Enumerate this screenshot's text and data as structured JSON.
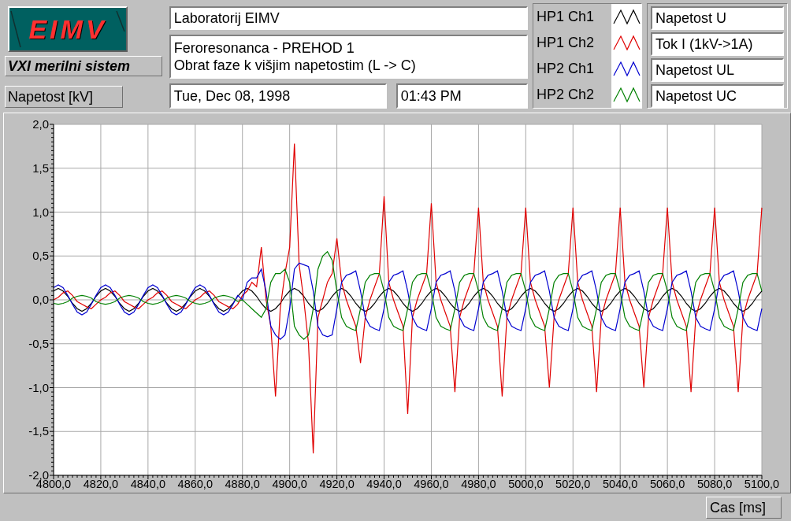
{
  "logo": {
    "text": "EIMV"
  },
  "system_label": "VXI merilni sistem",
  "y_axis_label": "Napetost [kV]",
  "header": {
    "lab": "Laboratorij EIMV",
    "description": [
      "Feroresonanca - PREHOD 1",
      "Obrat faze k višjim napetostim (L -> C)"
    ],
    "date": "Tue, Dec 08, 1998",
    "time": "01:43 PM"
  },
  "signals": [
    "Napetost U",
    "Tok I (1kV->1A)",
    "Napetost UL",
    "Napetost UC"
  ],
  "chart_data": {
    "type": "line",
    "grid": true,
    "xlim": [
      4800,
      5100
    ],
    "ylim": [
      -2,
      2
    ],
    "yticks": [
      {
        "value": 2,
        "label": "2,0"
      },
      {
        "value": 1.5,
        "label": "1,5"
      },
      {
        "value": 1,
        "label": "1,0"
      },
      {
        "value": 0.5,
        "label": "0,5"
      },
      {
        "value": 0,
        "label": "0,0"
      },
      {
        "value": -0.5,
        "label": "-0,5"
      },
      {
        "value": -1,
        "label": "-1,0"
      },
      {
        "value": -1.5,
        "label": "-1,5"
      },
      {
        "value": -2,
        "label": "-2,0"
      }
    ],
    "xticks": [
      {
        "value": 4800,
        "label": "4800,0"
      },
      {
        "value": 4820,
        "label": "4820,0"
      },
      {
        "value": 4840,
        "label": "4840,0"
      },
      {
        "value": 4860,
        "label": "4860,0"
      },
      {
        "value": 4880,
        "label": "4880,0"
      },
      {
        "value": 4900,
        "label": "4900,0"
      },
      {
        "value": 4920,
        "label": "4920,0"
      },
      {
        "value": 4940,
        "label": "4940,0"
      },
      {
        "value": 4960,
        "label": "4960,0"
      },
      {
        "value": 4980,
        "label": "4980,0"
      },
      {
        "value": 5000,
        "label": "5000,0"
      },
      {
        "value": 5020,
        "label": "5020,0"
      },
      {
        "value": 5040,
        "label": "5040,0"
      },
      {
        "value": 5060,
        "label": "5060,0"
      },
      {
        "value": 5080,
        "label": "5080,0"
      },
      {
        "value": 5100,
        "label": "5100,0"
      }
    ],
    "x": [
      4800,
      4802,
      4804,
      4806,
      4808,
      4810,
      4812,
      4814,
      4816,
      4818,
      4820,
      4822,
      4824,
      4826,
      4828,
      4830,
      4832,
      4834,
      4836,
      4838,
      4840,
      4842,
      4844,
      4846,
      4848,
      4850,
      4852,
      4854,
      4856,
      4858,
      4860,
      4862,
      4864,
      4866,
      4868,
      4870,
      4872,
      4874,
      4876,
      4878,
      4880,
      4882,
      4884,
      4886,
      4888,
      4890,
      4892,
      4894,
      4896,
      4898,
      4900,
      4902,
      4904,
      4906,
      4908,
      4910,
      4912,
      4914,
      4916,
      4918,
      4920,
      4922,
      4924,
      4926,
      4928,
      4930,
      4932,
      4934,
      4936,
      4938,
      4940,
      4942,
      4944,
      4946,
      4948,
      4950,
      4952,
      4954,
      4956,
      4958,
      4960,
      4962,
      4964,
      4966,
      4968,
      4970,
      4972,
      4974,
      4976,
      4978,
      4980,
      4982,
      4984,
      4986,
      4988,
      4990,
      4992,
      4994,
      4996,
      4998,
      5000,
      5002,
      5004,
      5006,
      5008,
      5010,
      5012,
      5014,
      5016,
      5018,
      5020,
      5022,
      5024,
      5026,
      5028,
      5030,
      5032,
      5034,
      5036,
      5038,
      5040,
      5042,
      5044,
      5046,
      5048,
      5050,
      5052,
      5054,
      5056,
      5058,
      5060,
      5062,
      5064,
      5066,
      5068,
      5070,
      5072,
      5074,
      5076,
      5078,
      5080,
      5082,
      5084,
      5086,
      5088,
      5090,
      5092,
      5094,
      5096,
      5098,
      5100
    ],
    "series": [
      {
        "name": "HP1 Ch1",
        "color": "#000000",
        "values": [
          0.1,
          0.13,
          0.1,
          0.04,
          -0.04,
          -0.1,
          -0.13,
          -0.1,
          -0.04,
          0.04,
          0.1,
          0.13,
          0.1,
          0.04,
          -0.04,
          -0.1,
          -0.13,
          -0.1,
          -0.04,
          0.04,
          0.1,
          0.13,
          0.1,
          0.04,
          -0.04,
          -0.1,
          -0.13,
          -0.1,
          -0.04,
          0.04,
          0.1,
          0.13,
          0.1,
          0.04,
          -0.04,
          -0.1,
          -0.13,
          -0.1,
          -0.04,
          0.04,
          0.1,
          0.13,
          0.1,
          0.04,
          -0.04,
          -0.1,
          -0.13,
          -0.1,
          -0.04,
          0.04,
          0.1,
          0.13,
          0.1,
          0.04,
          -0.04,
          -0.1,
          -0.13,
          -0.1,
          -0.04,
          0.04,
          0.1,
          0.13,
          0.1,
          0.04,
          -0.04,
          -0.1,
          -0.13,
          -0.1,
          -0.04,
          0.04,
          0.1,
          0.13,
          0.1,
          0.04,
          -0.04,
          -0.1,
          -0.13,
          -0.1,
          -0.04,
          0.04,
          0.1,
          0.13,
          0.1,
          0.04,
          -0.04,
          -0.1,
          -0.13,
          -0.1,
          -0.04,
          0.04,
          0.1,
          0.13,
          0.1,
          0.04,
          -0.04,
          -0.1,
          -0.13,
          -0.1,
          -0.04,
          0.04,
          0.1,
          0.13,
          0.1,
          0.04,
          -0.04,
          -0.1,
          -0.13,
          -0.1,
          -0.04,
          0.04,
          0.1,
          0.13,
          0.1,
          0.04,
          -0.04,
          -0.1,
          -0.13,
          -0.1,
          -0.04,
          0.04,
          0.1,
          0.13,
          0.1,
          0.04,
          -0.04,
          -0.1,
          -0.13,
          -0.1,
          -0.04,
          0.04,
          0.1,
          0.13,
          0.1,
          0.04,
          -0.04,
          -0.1,
          -0.13,
          -0.1,
          -0.04,
          0.04,
          0.1,
          0.13,
          0.1,
          0.04,
          -0.04,
          -0.1,
          -0.13,
          -0.1,
          -0.04,
          0.04,
          0.1
        ]
      },
      {
        "name": "HP1 Ch2",
        "color": "#e00000",
        "values": [
          0.0,
          0.03,
          0.08,
          0.1,
          0.05,
          -0.02,
          -0.05,
          -0.08,
          -0.1,
          -0.05,
          0.0,
          0.03,
          0.08,
          0.1,
          0.05,
          -0.02,
          -0.05,
          -0.08,
          -0.1,
          -0.05,
          0.0,
          0.03,
          0.08,
          0.1,
          0.05,
          -0.02,
          -0.05,
          -0.08,
          -0.1,
          -0.05,
          0.0,
          0.03,
          0.08,
          0.1,
          0.05,
          -0.02,
          -0.05,
          -0.08,
          -0.1,
          -0.05,
          0.05,
          0.1,
          0.2,
          0.15,
          0.6,
          0.0,
          -0.3,
          -1.1,
          -0.1,
          0.3,
          0.6,
          1.78,
          0.4,
          0.0,
          -0.5,
          -1.75,
          -0.2,
          0.0,
          0.2,
          0.3,
          0.7,
          0.2,
          0.0,
          -0.15,
          -0.3,
          -0.72,
          -0.2,
          0.0,
          0.15,
          0.3,
          1.18,
          0.2,
          0.0,
          -0.15,
          -0.3,
          -1.3,
          -0.2,
          0.0,
          0.15,
          0.3,
          1.1,
          0.2,
          0.0,
          -0.15,
          -0.3,
          -1.05,
          -0.2,
          0.0,
          0.15,
          0.3,
          1.05,
          0.2,
          0.0,
          -0.15,
          -0.3,
          -1.1,
          -0.2,
          0.0,
          0.15,
          0.3,
          1.05,
          0.2,
          0.0,
          -0.15,
          -0.3,
          -1.0,
          -0.2,
          0.0,
          0.15,
          0.3,
          1.05,
          0.2,
          0.0,
          -0.15,
          -0.3,
          -1.05,
          -0.2,
          0.0,
          0.15,
          0.3,
          1.05,
          0.2,
          0.0,
          -0.15,
          -0.3,
          -1.0,
          -0.2,
          0.0,
          0.15,
          0.3,
          1.05,
          0.2,
          0.0,
          -0.15,
          -0.3,
          -1.05,
          -0.2,
          0.0,
          0.15,
          0.3,
          1.05,
          0.2,
          0.0,
          -0.15,
          -0.3,
          -1.05,
          -0.2,
          0.0,
          0.15,
          0.3,
          1.05
        ]
      },
      {
        "name": "HP2 Ch1",
        "color": "#0000d0",
        "values": [
          0.14,
          0.17,
          0.14,
          0.05,
          -0.05,
          -0.14,
          -0.17,
          -0.14,
          -0.05,
          0.05,
          0.14,
          0.17,
          0.14,
          0.05,
          -0.05,
          -0.14,
          -0.17,
          -0.14,
          -0.05,
          0.05,
          0.14,
          0.17,
          0.14,
          0.05,
          -0.05,
          -0.14,
          -0.17,
          -0.14,
          -0.05,
          0.05,
          0.14,
          0.17,
          0.14,
          0.05,
          -0.05,
          -0.14,
          -0.17,
          -0.14,
          -0.05,
          0.05,
          0.0,
          0.2,
          0.25,
          0.25,
          0.35,
          0.1,
          -0.3,
          -0.4,
          -0.45,
          -0.4,
          -0.1,
          0.35,
          0.42,
          0.4,
          0.38,
          0.1,
          -0.3,
          -0.4,
          -0.42,
          -0.4,
          -0.1,
          0.2,
          0.28,
          0.3,
          0.33,
          0.1,
          -0.2,
          -0.3,
          -0.33,
          -0.35,
          -0.1,
          0.2,
          0.28,
          0.3,
          0.33,
          0.1,
          -0.2,
          -0.3,
          -0.33,
          -0.35,
          -0.1,
          0.2,
          0.28,
          0.3,
          0.33,
          0.1,
          -0.2,
          -0.3,
          -0.33,
          -0.35,
          -0.1,
          0.2,
          0.28,
          0.3,
          0.33,
          0.1,
          -0.2,
          -0.3,
          -0.33,
          -0.35,
          -0.1,
          0.2,
          0.28,
          0.3,
          0.33,
          0.1,
          -0.2,
          -0.3,
          -0.33,
          -0.35,
          -0.1,
          0.2,
          0.28,
          0.3,
          0.33,
          0.1,
          -0.2,
          -0.3,
          -0.33,
          -0.35,
          -0.1,
          0.2,
          0.28,
          0.3,
          0.33,
          0.1,
          -0.2,
          -0.3,
          -0.33,
          -0.35,
          -0.1,
          0.2,
          0.28,
          0.3,
          0.33,
          0.1,
          -0.2,
          -0.3,
          -0.33,
          -0.35,
          -0.1,
          0.2,
          0.28,
          0.3,
          0.33,
          0.1,
          -0.2,
          -0.3,
          -0.33,
          -0.35,
          -0.1
        ]
      },
      {
        "name": "HP2 Ch2",
        "color": "#008000",
        "values": [
          -0.04,
          -0.05,
          -0.04,
          -0.02,
          0.02,
          0.04,
          0.05,
          0.04,
          0.02,
          -0.02,
          -0.04,
          -0.05,
          -0.04,
          -0.02,
          0.02,
          0.04,
          0.05,
          0.04,
          0.02,
          -0.02,
          -0.04,
          -0.05,
          -0.04,
          -0.02,
          0.02,
          0.04,
          0.05,
          0.04,
          0.02,
          -0.02,
          -0.04,
          -0.05,
          -0.04,
          -0.02,
          0.02,
          0.04,
          0.05,
          0.04,
          0.02,
          -0.02,
          0.0,
          -0.05,
          -0.1,
          -0.15,
          -0.2,
          -0.1,
          0.2,
          0.3,
          0.3,
          0.35,
          0.2,
          -0.3,
          -0.4,
          -0.45,
          -0.4,
          -0.1,
          0.35,
          0.5,
          0.55,
          0.45,
          0.1,
          -0.2,
          -0.3,
          -0.33,
          -0.35,
          -0.1,
          0.2,
          0.28,
          0.3,
          0.3,
          0.1,
          -0.2,
          -0.3,
          -0.33,
          -0.35,
          -0.1,
          0.2,
          0.28,
          0.3,
          0.3,
          0.1,
          -0.2,
          -0.3,
          -0.33,
          -0.35,
          -0.1,
          0.2,
          0.28,
          0.3,
          0.3,
          0.1,
          -0.2,
          -0.3,
          -0.33,
          -0.35,
          -0.1,
          0.2,
          0.28,
          0.3,
          0.3,
          0.1,
          -0.2,
          -0.3,
          -0.33,
          -0.35,
          -0.1,
          0.2,
          0.28,
          0.3,
          0.3,
          0.1,
          -0.2,
          -0.3,
          -0.33,
          -0.35,
          -0.1,
          0.2,
          0.28,
          0.3,
          0.3,
          0.1,
          -0.2,
          -0.3,
          -0.33,
          -0.35,
          -0.1,
          0.2,
          0.28,
          0.3,
          0.3,
          0.1,
          -0.2,
          -0.3,
          -0.33,
          -0.35,
          -0.1,
          0.2,
          0.28,
          0.3,
          0.3,
          0.1,
          -0.2,
          -0.3,
          -0.33,
          -0.35,
          -0.1,
          0.2,
          0.28,
          0.3,
          0.3,
          0.1
        ]
      }
    ]
  },
  "x_axis_label": "Cas [ms]"
}
